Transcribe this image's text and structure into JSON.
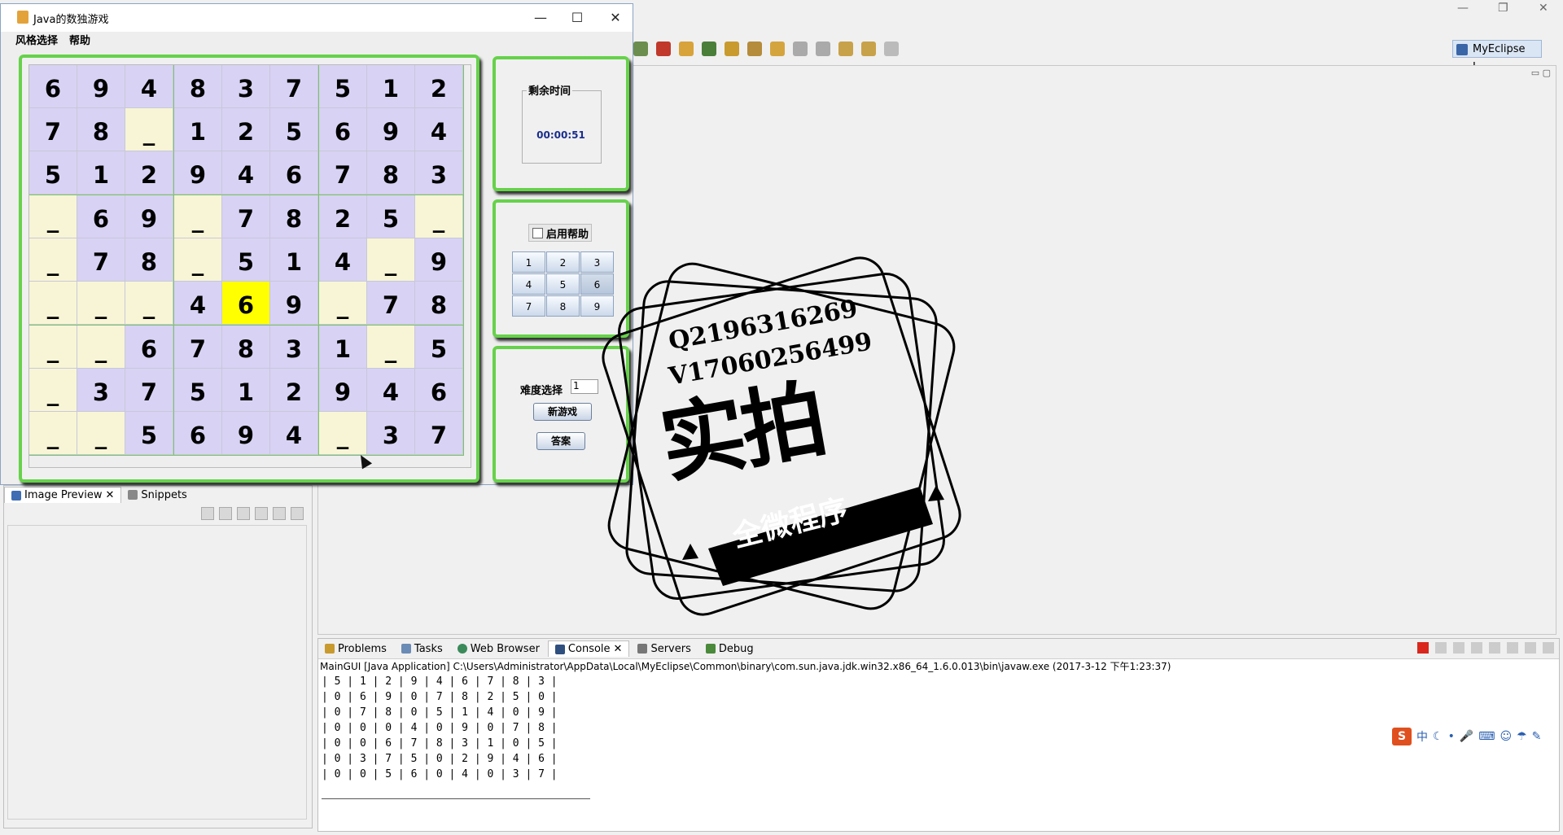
{
  "window": {
    "title": "Java的数独游戏",
    "menu": [
      "风格选择",
      "帮助"
    ],
    "controls": {
      "minimize": "—",
      "maximize": "☐",
      "close": "✕"
    }
  },
  "board": {
    "cells": [
      [
        "6",
        "9",
        "4",
        "8",
        "3",
        "7",
        "5",
        "1",
        "2"
      ],
      [
        "7",
        "8",
        "_",
        "1",
        "2",
        "5",
        "6",
        "9",
        "4"
      ],
      [
        "5",
        "1",
        "2",
        "9",
        "4",
        "6",
        "7",
        "8",
        "3"
      ],
      [
        "_",
        "6",
        "9",
        "_",
        "7",
        "8",
        "2",
        "5",
        "_"
      ],
      [
        "_",
        "7",
        "8",
        "_",
        "5",
        "1",
        "4",
        "_",
        "9"
      ],
      [
        "_",
        "_",
        "_",
        "4",
        "6",
        "9",
        "_",
        "7",
        "8"
      ],
      [
        "_",
        "_",
        "6",
        "7",
        "8",
        "3",
        "1",
        "_",
        "5"
      ],
      [
        "_",
        "3",
        "7",
        "5",
        "1",
        "2",
        "9",
        "4",
        "6"
      ],
      [
        "_",
        "_",
        "5",
        "6",
        "9",
        "4",
        "_",
        "3",
        "7"
      ]
    ],
    "selected": [
      5,
      4
    ],
    "colors": {
      "given": "#d8d2f4",
      "blank": "#f8f5d6",
      "selected": "#ffff00",
      "border": "#66d24a"
    }
  },
  "timer": {
    "label": "剩余时间",
    "value": "00:00:51"
  },
  "help": {
    "toggle_label": "启用帮助",
    "keys": [
      "1",
      "2",
      "3",
      "4",
      "5",
      "6",
      "7",
      "8",
      "9"
    ],
    "pressed_key": "6"
  },
  "difficulty": {
    "label": "难度选择",
    "value": "1",
    "new_game": "新游戏",
    "answer": "答案"
  },
  "ide": {
    "perspective": "MyEclipse J...",
    "left_tabs": [
      "Image Preview",
      "Snippets"
    ],
    "console_tabs": [
      "Problems",
      "Tasks",
      "Web Browser",
      "Console",
      "Servers",
      "Debug"
    ],
    "console_info": "MainGUI [Java Application] C:\\Users\\Administrator\\AppData\\Local\\MyEclipse\\Common\\binary\\com.sun.java.jdk.win32.x86_64_1.6.0.013\\bin\\javaw.exe (2017-3-12 下午1:23:37)",
    "console_lines": [
      "| 5 | 1 | 2 | 9 | 4 | 6 | 7 | 8 | 3 |",
      "| 0 | 6 | 9 | 0 | 7 | 8 | 2 | 5 | 0 |",
      "| 0 | 7 | 8 | 0 | 5 | 1 | 4 | 0 | 9 |",
      "| 0 | 0 | 0 | 4 | 0 | 9 | 0 | 7 | 8 |",
      "| 0 | 0 | 6 | 7 | 8 | 3 | 1 | 0 | 5 |",
      "| 0 | 3 | 7 | 5 | 0 | 2 | 9 | 4 | 6 |",
      "| 0 | 0 | 5 | 6 | 0 | 4 | 0 | 3 | 7 |"
    ],
    "ime": [
      "S",
      "中"
    ]
  },
  "watermark": {
    "line1": "Q2196316269",
    "line2": "V17060256499",
    "big": "实拍",
    "ribbon": "全微程序"
  }
}
